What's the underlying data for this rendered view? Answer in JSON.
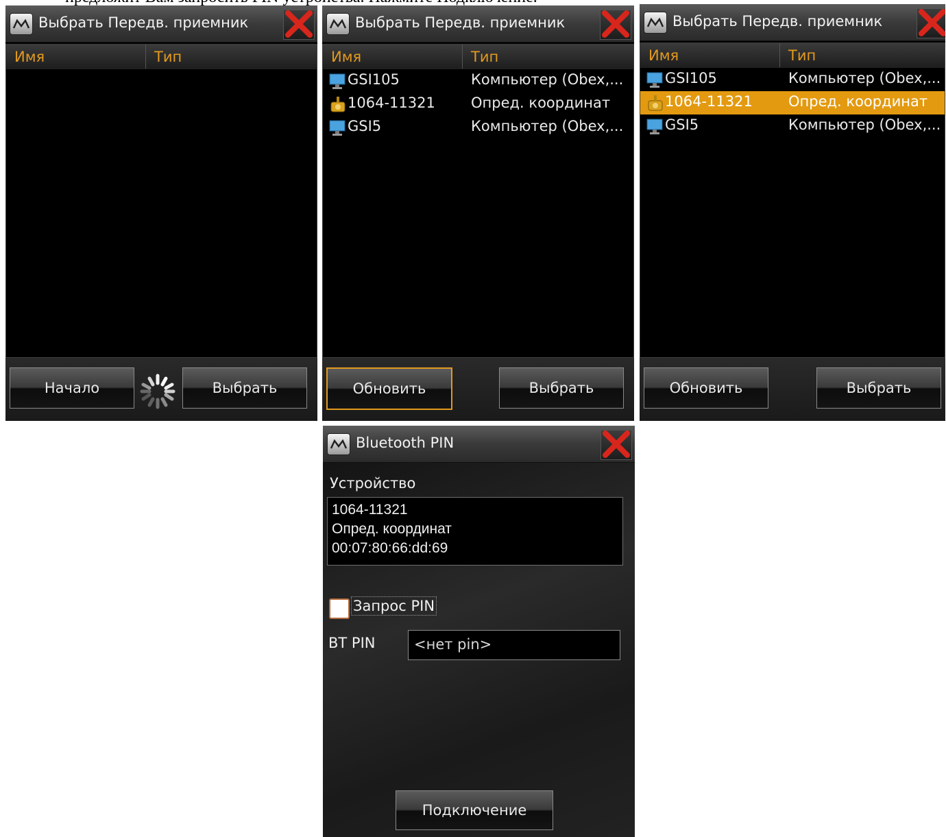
{
  "doc_fragment_text": "предложит Вам запросить PIN устройства. Нажмите Подключение.",
  "panel1": {
    "title": "Выбрать Передв. приемник",
    "columns": {
      "name": "Имя",
      "type": "Тип"
    },
    "buttons": {
      "left": "Начало",
      "right": "Выбрать"
    }
  },
  "panel2": {
    "title": "Выбрать Передв. приемник",
    "columns": {
      "name": "Имя",
      "type": "Тип"
    },
    "rows": [
      {
        "name": "GSI105",
        "type": "Компьютер (Obex,...",
        "icon": "computer-icon"
      },
      {
        "name": "1064-11321",
        "type": "Опред. координат",
        "icon": "gps-receiver-icon"
      },
      {
        "name": "GSI5",
        "type": "Компьютер (Obex,...",
        "icon": "computer-icon"
      }
    ],
    "buttons": {
      "left": "Обновить",
      "right": "Выбрать"
    }
  },
  "panel3": {
    "title": "Выбрать Передв. приемник",
    "columns": {
      "name": "Имя",
      "type": "Тип"
    },
    "rows": [
      {
        "name": "GSI105",
        "type": "Компьютер (Obex,...",
        "icon": "computer-icon"
      },
      {
        "name": "1064-11321",
        "type": "Опред. координат",
        "icon": "gps-receiver-icon",
        "selected": true
      },
      {
        "name": "GSI5",
        "type": "Компьютер (Obex,...",
        "icon": "computer-icon"
      }
    ],
    "buttons": {
      "left": "Обновить",
      "right": "Выбрать"
    }
  },
  "pin_dialog": {
    "title": "Bluetooth PIN",
    "device_label": "Устройство",
    "device_name": "1064-11321",
    "device_type": "Опред. координат",
    "device_address": "00:07:80:66:dd:69",
    "checkbox_label": "Запрос PIN",
    "pin_label": "BT PIN",
    "pin_value": "<нет pin>",
    "connect_label": "Подключение"
  },
  "colors": {
    "accent": "#e39a1e",
    "selection": "#e39a10",
    "background": "#000000"
  }
}
